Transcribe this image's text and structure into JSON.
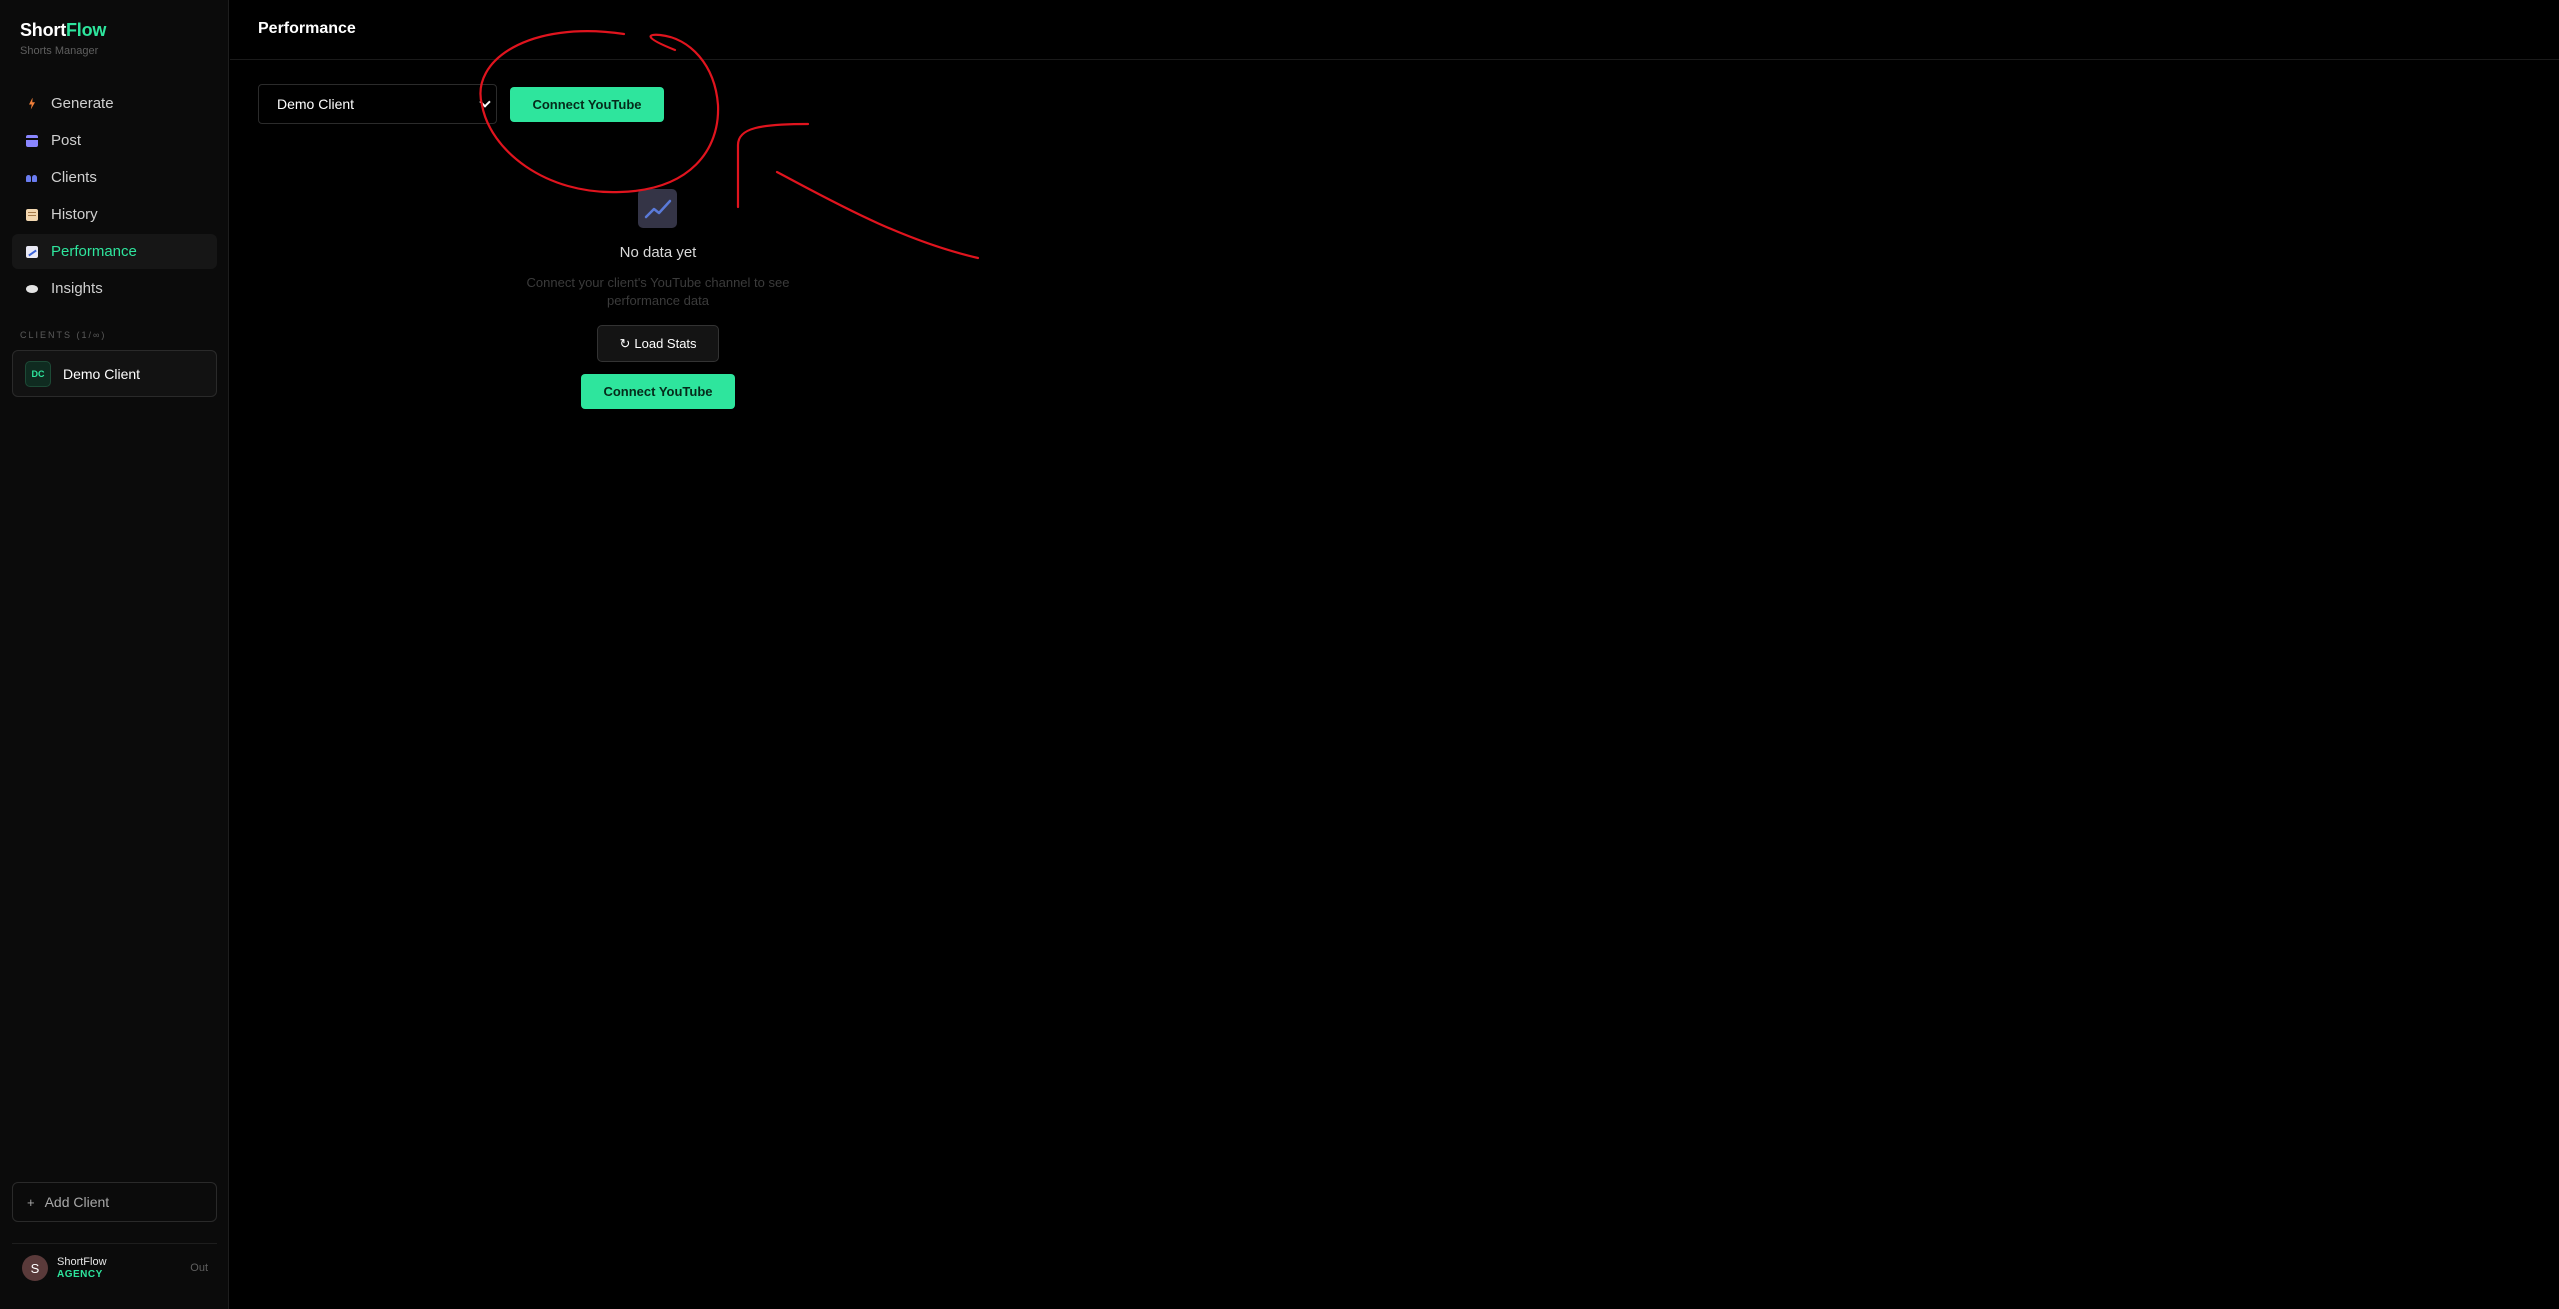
{
  "brand": {
    "name_part1": "Short",
    "name_part2": "Flow",
    "subtitle": "Shorts Manager",
    "accent_color": "#2ee59d"
  },
  "sidebar": {
    "items": [
      {
        "label": "Generate",
        "icon": "bolt-icon",
        "active": false
      },
      {
        "label": "Post",
        "icon": "clapper-icon",
        "active": false
      },
      {
        "label": "Clients",
        "icon": "people-icon",
        "active": false
      },
      {
        "label": "History",
        "icon": "scroll-icon",
        "active": false
      },
      {
        "label": "Performance",
        "icon": "chart-icon",
        "active": true
      },
      {
        "label": "Insights",
        "icon": "speech-bubble-icon",
        "active": false
      }
    ],
    "clients_section_label": "CLIENTS (1/∞)",
    "clients": [
      {
        "initials": "DC",
        "name": "Demo Client"
      }
    ],
    "add_client_label": "Add Client",
    "user": {
      "avatar_initial": "S",
      "name": "ShortFlow",
      "plan": "AGENCY",
      "signout_label": "Out"
    }
  },
  "header": {
    "title": "Performance"
  },
  "toolbar": {
    "client_select_value": "Demo Client",
    "connect_label": "Connect YouTube"
  },
  "empty_state": {
    "icon": "chart-icon",
    "title": "No data yet",
    "description": "Connect your client's YouTube channel to see performance data",
    "load_stats_label": "Load Stats",
    "connect_label": "Connect YouTube"
  },
  "annotation_color": "#e0141e"
}
